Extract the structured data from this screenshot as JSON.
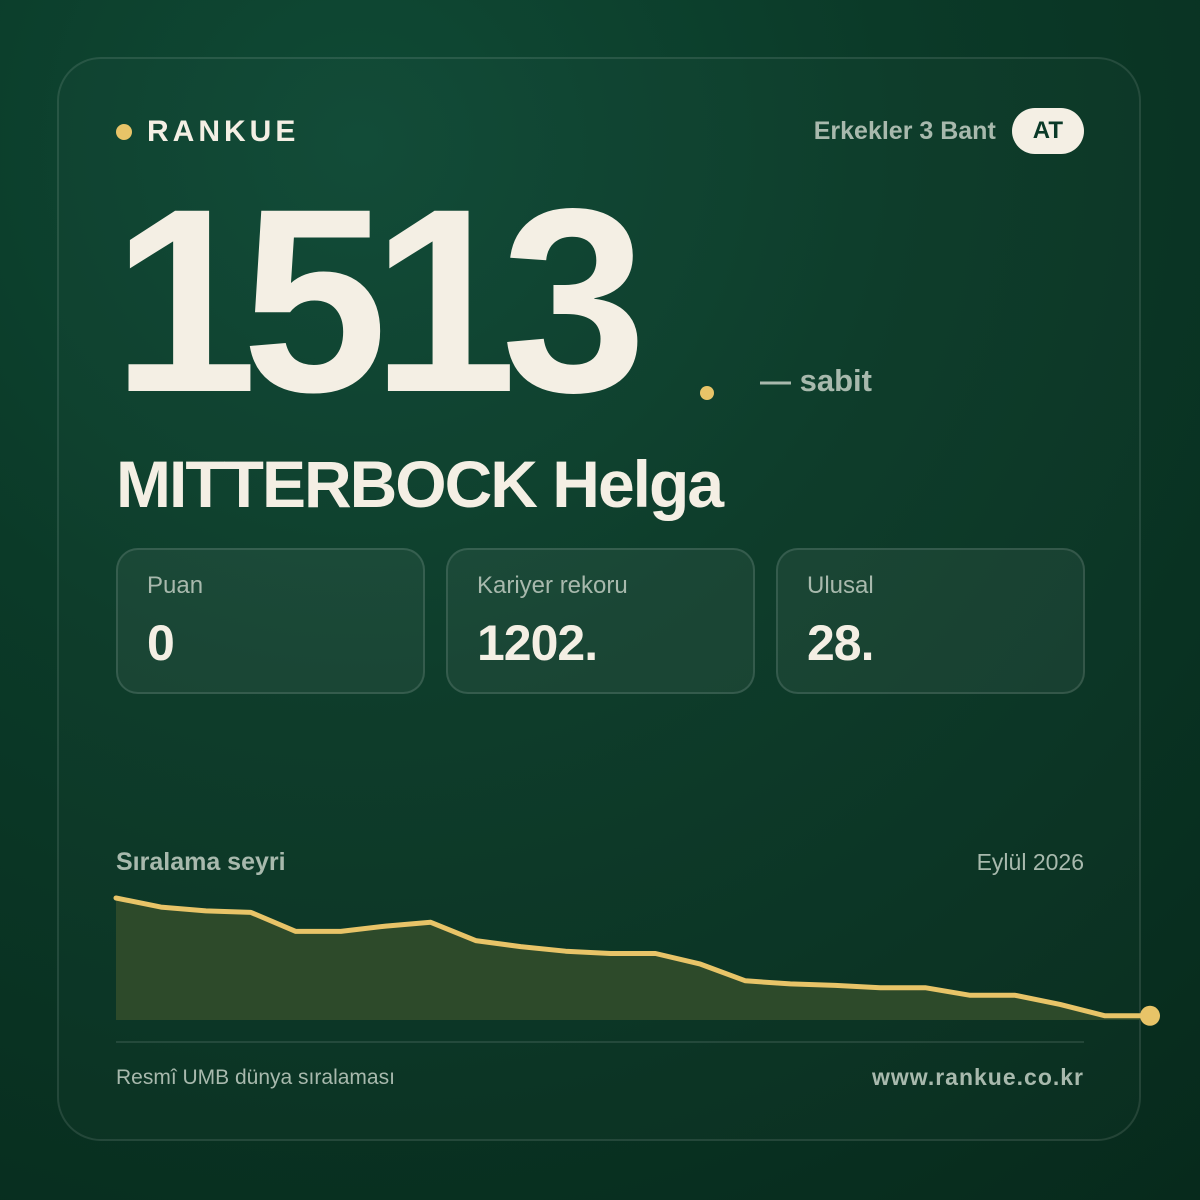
{
  "brand": {
    "name": "RANKUE"
  },
  "category": {
    "label": "Erkekler 3 Bant",
    "country_code": "AT"
  },
  "ranking": {
    "rank": "1513",
    "change_text": "— sabit"
  },
  "athlete": {
    "name": "MITTERBOCK Helga"
  },
  "stats": [
    {
      "label": "Puan",
      "value": "0"
    },
    {
      "label": "Kariyer rekoru",
      "value": "1202."
    },
    {
      "label": "Ulusal",
      "value": "28."
    }
  ],
  "chart": {
    "title": "Sıralama seyri",
    "date": "Eylül 2026"
  },
  "chart_data": {
    "type": "area",
    "y_inverted": true,
    "ylim": [
      1500,
      1350
    ],
    "values": [
      1350,
      1362,
      1367,
      1369,
      1394,
      1394,
      1387,
      1382,
      1406,
      1414,
      1420,
      1423,
      1423,
      1437,
      1459,
      1463,
      1465,
      1468,
      1468,
      1478,
      1478,
      1490,
      1505,
      1505
    ],
    "colors": {
      "line": "#e8c468",
      "fill": "#2d4a2a"
    }
  },
  "footer": {
    "source": "Resmî UMB dünya sıralaması",
    "website": "www.rankue.co.kr"
  }
}
